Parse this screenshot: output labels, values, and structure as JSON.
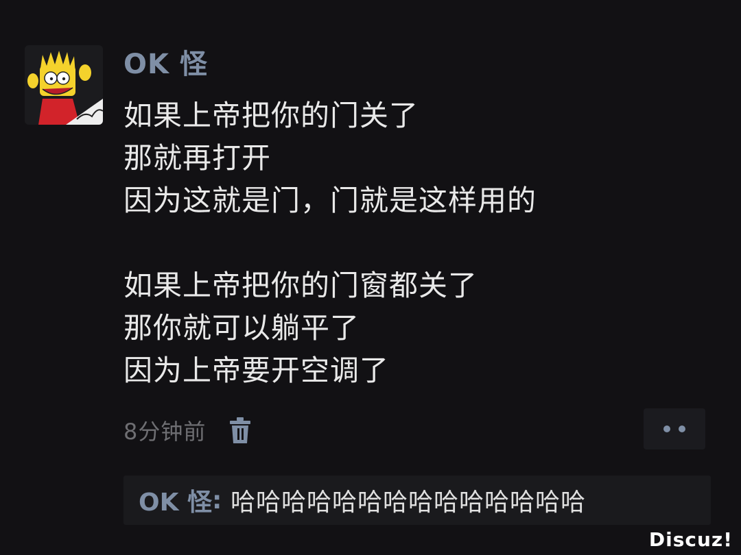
{
  "post": {
    "username": "OK 怪",
    "lines": [
      "如果上帝把你的门关了",
      "那就再打开",
      "因为这就是门，门就是这样用的",
      "",
      "如果上帝把你的门窗都关了",
      "那你就可以躺平了",
      "因为上帝要开空调了"
    ],
    "timestamp": "8分钟前"
  },
  "comment": {
    "author": "OK 怪",
    "separator": ": ",
    "text": "哈哈哈哈哈哈哈哈哈哈哈哈哈哈"
  },
  "icons": {
    "avatar": "cartoon-avatar",
    "delete": "trash-icon",
    "more": "more-dots-icon"
  },
  "colors": {
    "background": "#121114",
    "username": "#7f8fa6",
    "text": "#e9e9e9",
    "meta": "#6e6e72"
  },
  "watermark": "Discuz!"
}
